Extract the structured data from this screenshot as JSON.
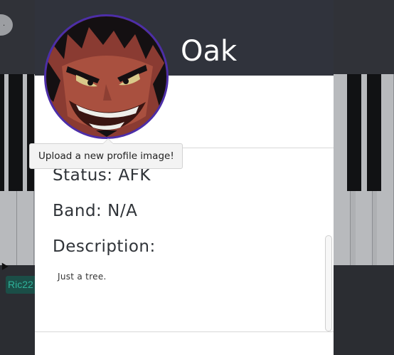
{
  "background": {
    "user_tag": "Ric22",
    "overlay_color": "#3b3d44"
  },
  "modal": {
    "title": "Oak",
    "header_color": "#30333c",
    "avatar": {
      "icon": "profile-avatar-image",
      "ring_color": "#4c2ea8"
    },
    "tooltip": "Upload a new profile image!",
    "status": "Status: AFK",
    "band": "Band: N/A",
    "description_label": "Description:",
    "description_text": "Just a tree."
  }
}
